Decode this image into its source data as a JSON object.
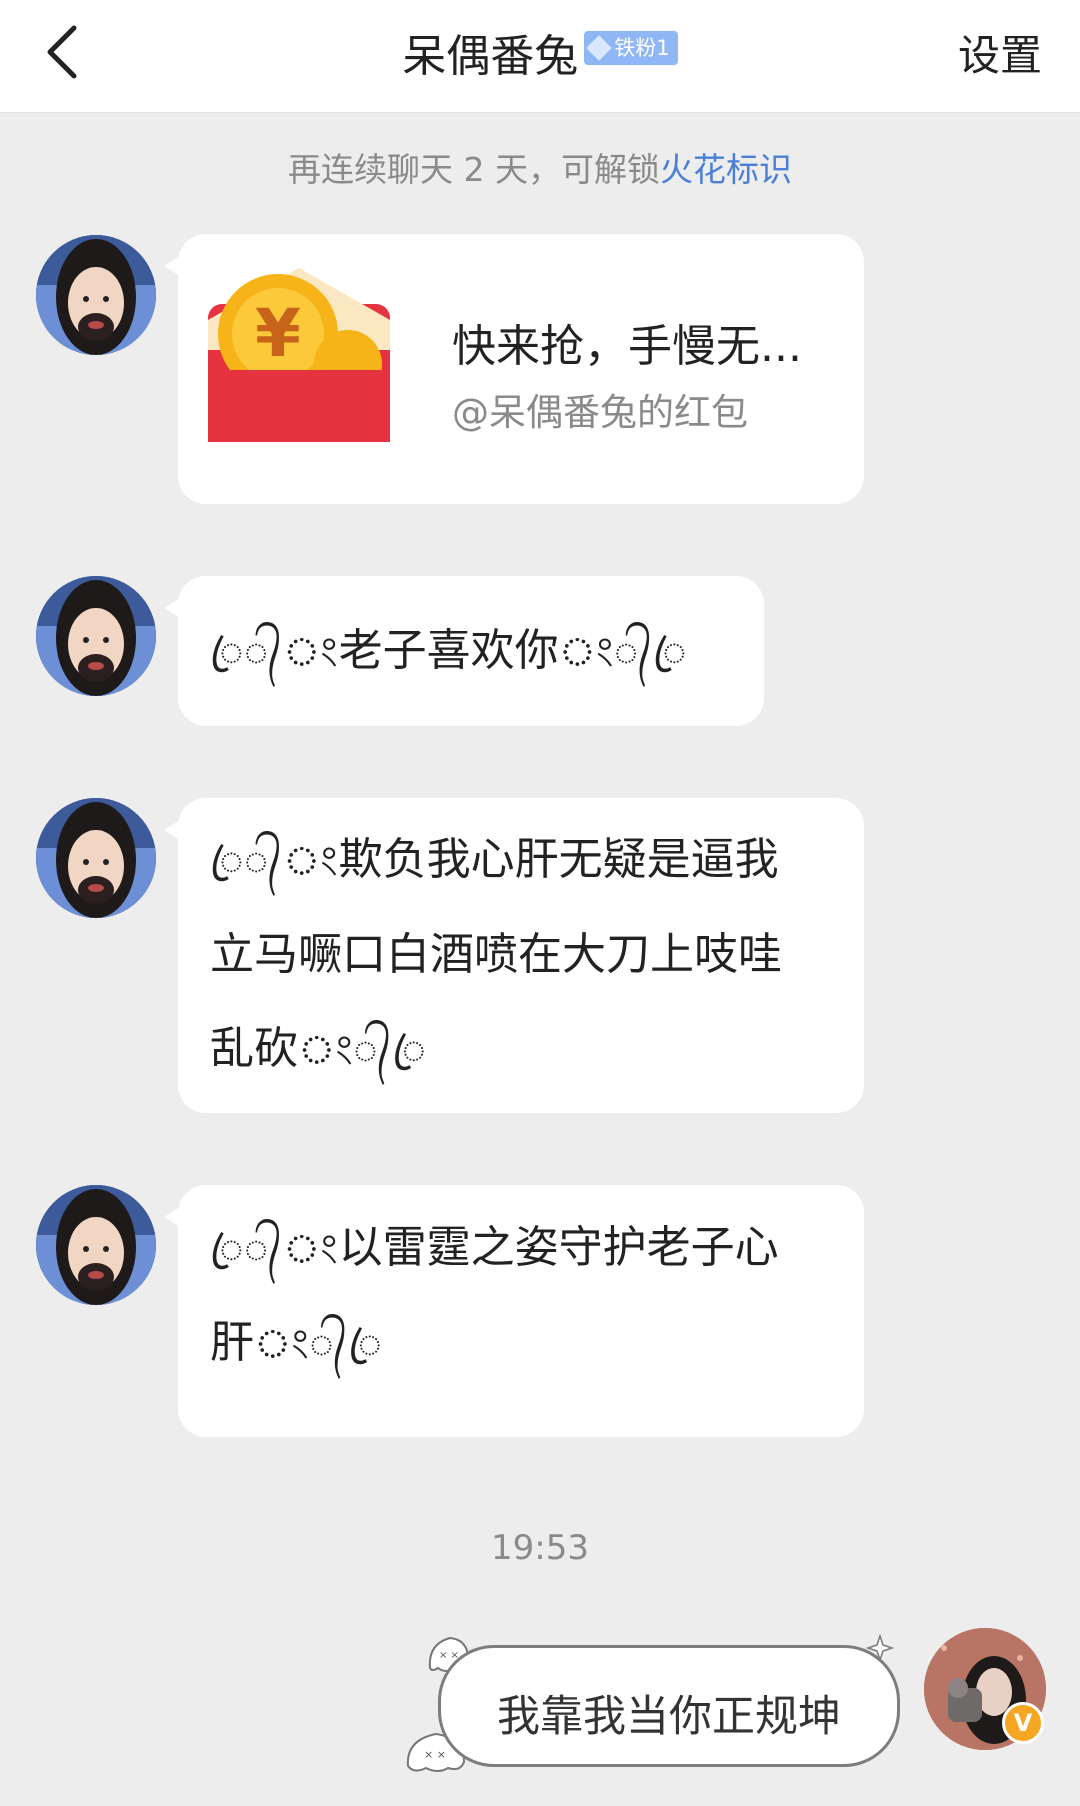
{
  "header": {
    "back_icon": "chevron-left-icon",
    "title": "呆偶番兔",
    "fan_badge": "铁粉1",
    "settings_label": "设置"
  },
  "notice": {
    "prefix": "再连续聊天 2 天，可解锁",
    "link": "火花标识"
  },
  "messages": [
    {
      "type": "red_packet",
      "title": "快来抢，手慢无...",
      "sender_line": "@呆偶番兔的红包"
    },
    {
      "type": "text",
      "orn_left": "ꦿ᭄ং",
      "text": "老子喜欢你",
      "orn_right": "ং᭄ꦿ"
    },
    {
      "type": "text",
      "orn_left": "ꦿ᭄ং",
      "line1": "欺负我心肝无疑是逼我",
      "line2": "立马噘口白酒喷在大刀上吱哇",
      "line3": "乱砍",
      "orn_right": "ং᭄ꦿ"
    },
    {
      "type": "text",
      "orn_left": "ꦿ᭄ং",
      "line1": "以雷霆之姿守护老子心",
      "line2": "肝",
      "orn_right": "ং᭄ꦿ"
    }
  ],
  "timestamp": "19:53",
  "my_message": {
    "text": "我靠我当你正规坤",
    "verified_badge": "V"
  },
  "colors": {
    "link_blue": "#4b7fd8",
    "red_packet": "#e5343f",
    "coin": "#f6b419",
    "background": "#ededed"
  }
}
